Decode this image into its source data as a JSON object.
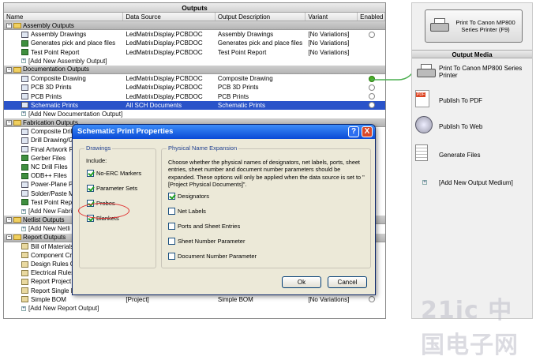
{
  "outputs_panel": {
    "title": "Outputs",
    "columns": [
      "Name",
      "Data Source",
      "Output Description",
      "Variant",
      "Enabled"
    ],
    "groups": [
      {
        "name": "Assembly Outputs",
        "rows": [
          {
            "name": "Assembly Drawings",
            "source": "LedMatrixDisplay.PCBDOC",
            "desc": "Assembly Drawings",
            "variant": "[No Variations]",
            "enabled": false,
            "icon": "drawing-icon"
          },
          {
            "name": "Generates pick and place files",
            "source": "LedMatrixDisplay.PCBDOC",
            "desc": "Generates pick and place files",
            "variant": "[No Variations]",
            "enabled": null,
            "icon": "pcb-icon"
          },
          {
            "name": "Test Point Report",
            "source": "LedMatrixDisplay.PCBDOC",
            "desc": "Test Point Report",
            "variant": "[No Variations]",
            "enabled": null,
            "icon": "pcb-icon"
          }
        ],
        "add": "[Add New Assembly Output]"
      },
      {
        "name": "Documentation Outputs",
        "rows": [
          {
            "name": "Composite Drawing",
            "source": "LedMatrixDisplay.PCBDOC",
            "desc": "Composite Drawing",
            "variant": "",
            "enabled": true,
            "icon": "drawing-icon"
          },
          {
            "name": "PCB 3D Prints",
            "source": "LedMatrixDisplay.PCBDOC",
            "desc": "PCB 3D Prints",
            "variant": "",
            "enabled": false,
            "icon": "drawing-icon"
          },
          {
            "name": "PCB Prints",
            "source": "LedMatrixDisplay.PCBDOC",
            "desc": "PCB Prints",
            "variant": "",
            "enabled": false,
            "icon": "drawing-icon"
          },
          {
            "name": "Schematic Prints",
            "source": "All SCH Documents",
            "desc": "Schematic Prints",
            "variant": "",
            "enabled": false,
            "icon": "drawing-icon",
            "selected": true
          }
        ],
        "add": "[Add New Documentation Output]"
      },
      {
        "name": "Fabrication Outputs",
        "rows": [
          {
            "name": "Composite Drill",
            "icon": "drawing-icon"
          },
          {
            "name": "Drill Drawing/Gu",
            "icon": "drawing-icon"
          },
          {
            "name": "Final Artwork Pr",
            "icon": "drawing-icon"
          },
          {
            "name": "Gerber Files",
            "icon": "pcb-icon"
          },
          {
            "name": "NC Drill Files",
            "icon": "pcb-icon"
          },
          {
            "name": "ODB++ Files",
            "icon": "pcb-icon"
          },
          {
            "name": "Power-Plane Pri",
            "icon": "drawing-icon"
          },
          {
            "name": "Solder/Paste M",
            "icon": "drawing-icon"
          },
          {
            "name": "Test Point Repo",
            "icon": "pcb-icon"
          }
        ],
        "add": "[Add New Fabri"
      },
      {
        "name": "Netlist Outputs",
        "rows": [],
        "add": "[Add New Netli"
      },
      {
        "name": "Report Outputs",
        "rows": [
          {
            "name": "Bill of Materials",
            "icon": "bom-icon"
          },
          {
            "name": "Component Cro",
            "icon": "bom-icon"
          },
          {
            "name": "Design Rules Ch",
            "icon": "bom-icon"
          },
          {
            "name": "Electrical Rules",
            "icon": "bom-icon"
          },
          {
            "name": "Report Project H",
            "icon": "bom-icon"
          },
          {
            "name": "Report Single P",
            "icon": "bom-icon"
          },
          {
            "name": "Simple BOM",
            "source": "[Project]",
            "desc": "Simple BOM",
            "variant": "[No Variations]",
            "enabled": false,
            "icon": "bom-icon"
          }
        ],
        "add": "[Add New Report Output]"
      }
    ]
  },
  "media_panel": {
    "print_button": "Print To Canon MP800 Series Printer (F9)",
    "title": "Output Media",
    "items": [
      {
        "label": "Print To Canon MP800 Series Printer",
        "icon": "printer-icon"
      },
      {
        "label": "Publish To PDF",
        "icon": "pdf-icon"
      },
      {
        "label": "Publish To Web",
        "icon": "globe-icon"
      },
      {
        "label": "Generate Files",
        "icon": "document-icon"
      },
      {
        "label": "[Add New Output Medium]",
        "icon": "add-icon"
      }
    ]
  },
  "dialog": {
    "title": "Schematic Print Properties",
    "help": "?",
    "close": "X",
    "drawings_label": "Drawings",
    "include_label": "Include:",
    "drawings": [
      {
        "label": "No-ERC Markers",
        "checked": true
      },
      {
        "label": "Parameter Sets",
        "checked": true
      },
      {
        "label": "Probes",
        "checked": true
      },
      {
        "label": "Blankets",
        "checked": true
      }
    ],
    "physical_label": "Physical Name Expansion",
    "physical_desc": "Choose whether the physical names of designators, net labels, ports, sheet entries, sheet number and document number parameters should be expanded. These options will only be applied when the data source is set to \"[Project Physical Documents]\".",
    "physical": [
      {
        "label": "Designators",
        "checked": true
      },
      {
        "label": "Net Labels",
        "checked": false
      },
      {
        "label": "Ports and Sheet Entries",
        "checked": false
      },
      {
        "label": "Sheet Number Parameter",
        "checked": false
      },
      {
        "label": "Document Number Parameter",
        "checked": false
      }
    ],
    "ok": "Ok",
    "cancel": "Cancel"
  },
  "watermark": "21ic 中国电子网",
  "colors": {
    "selection": "#2a53c9",
    "title_bar": "#0a4ad6",
    "highlight_circle": "#e03030",
    "connector": "#4caf50"
  }
}
